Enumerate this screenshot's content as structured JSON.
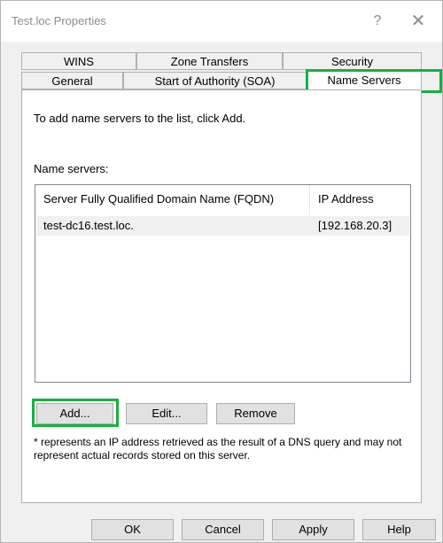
{
  "window": {
    "title": "Test.loc Properties",
    "help_glyph": "?",
    "close_glyph": "✕"
  },
  "tabs": {
    "row1": [
      {
        "label": "WINS"
      },
      {
        "label": "Zone Transfers"
      },
      {
        "label": "Security"
      }
    ],
    "row2": [
      {
        "label": "General"
      },
      {
        "label": "Start of Authority (SOA)"
      },
      {
        "label": "Name Servers"
      }
    ]
  },
  "panel": {
    "instruction": "To add name servers to the list, click Add.",
    "list_label": "Name servers:",
    "columns": [
      "Server Fully Qualified Domain Name (FQDN)",
      "IP Address"
    ],
    "rows": [
      {
        "fqdn": "test-dc16.test.loc.",
        "ip": "[192.168.20.3]"
      }
    ],
    "buttons": {
      "add": "Add...",
      "edit": "Edit...",
      "remove": "Remove"
    },
    "note": "* represents an IP address retrieved as the result of a DNS query and may not represent actual records stored on this server."
  },
  "footer": {
    "ok": "OK",
    "cancel": "Cancel",
    "apply": "Apply",
    "help": "Help"
  },
  "colors": {
    "highlight": "#17b03f",
    "row_bg": "#f0f0f0"
  }
}
